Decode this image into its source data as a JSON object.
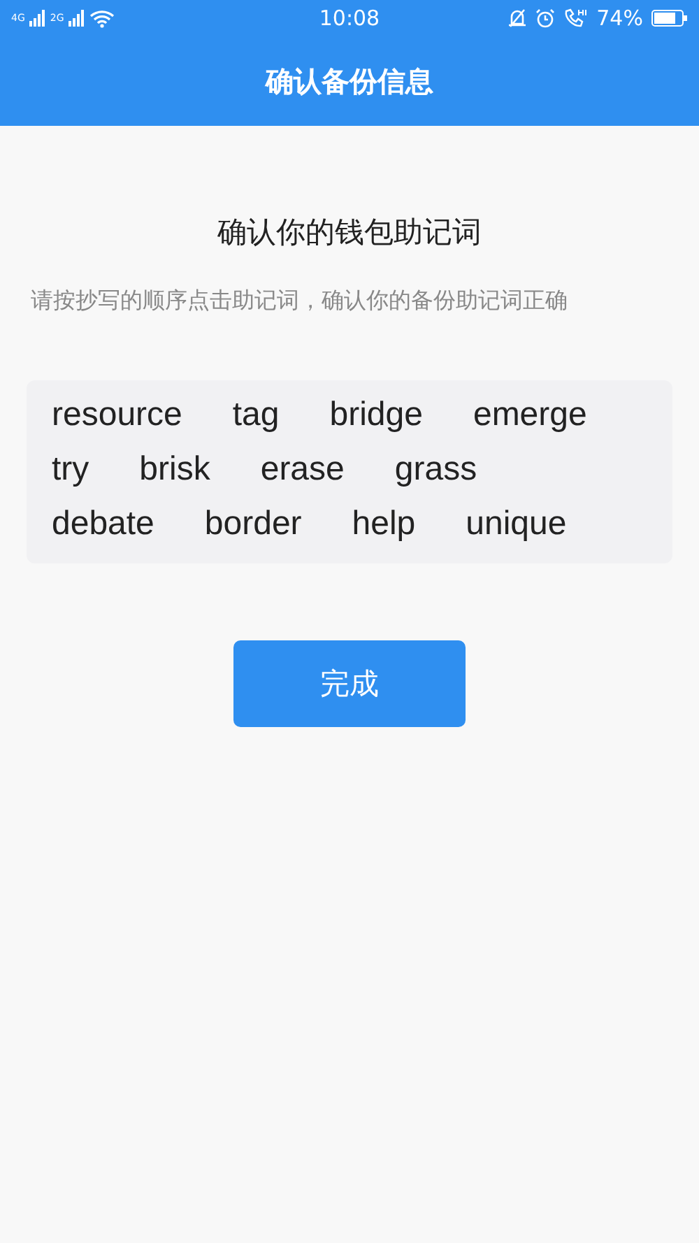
{
  "status_bar": {
    "network_1": "4G",
    "network_2": "2G",
    "time": "10:08",
    "battery_text": "74%"
  },
  "header": {
    "title": "确认备份信息"
  },
  "heading": "确认你的钱包助记词",
  "instruction": "请按抄写的顺序点击助记词，确认你的备份助记词正确",
  "words": [
    "resource",
    "tag",
    "bridge",
    "emerge",
    "try",
    "brisk",
    "erase",
    "grass",
    "debate",
    "border",
    "help",
    "unique"
  ],
  "button": "完成"
}
